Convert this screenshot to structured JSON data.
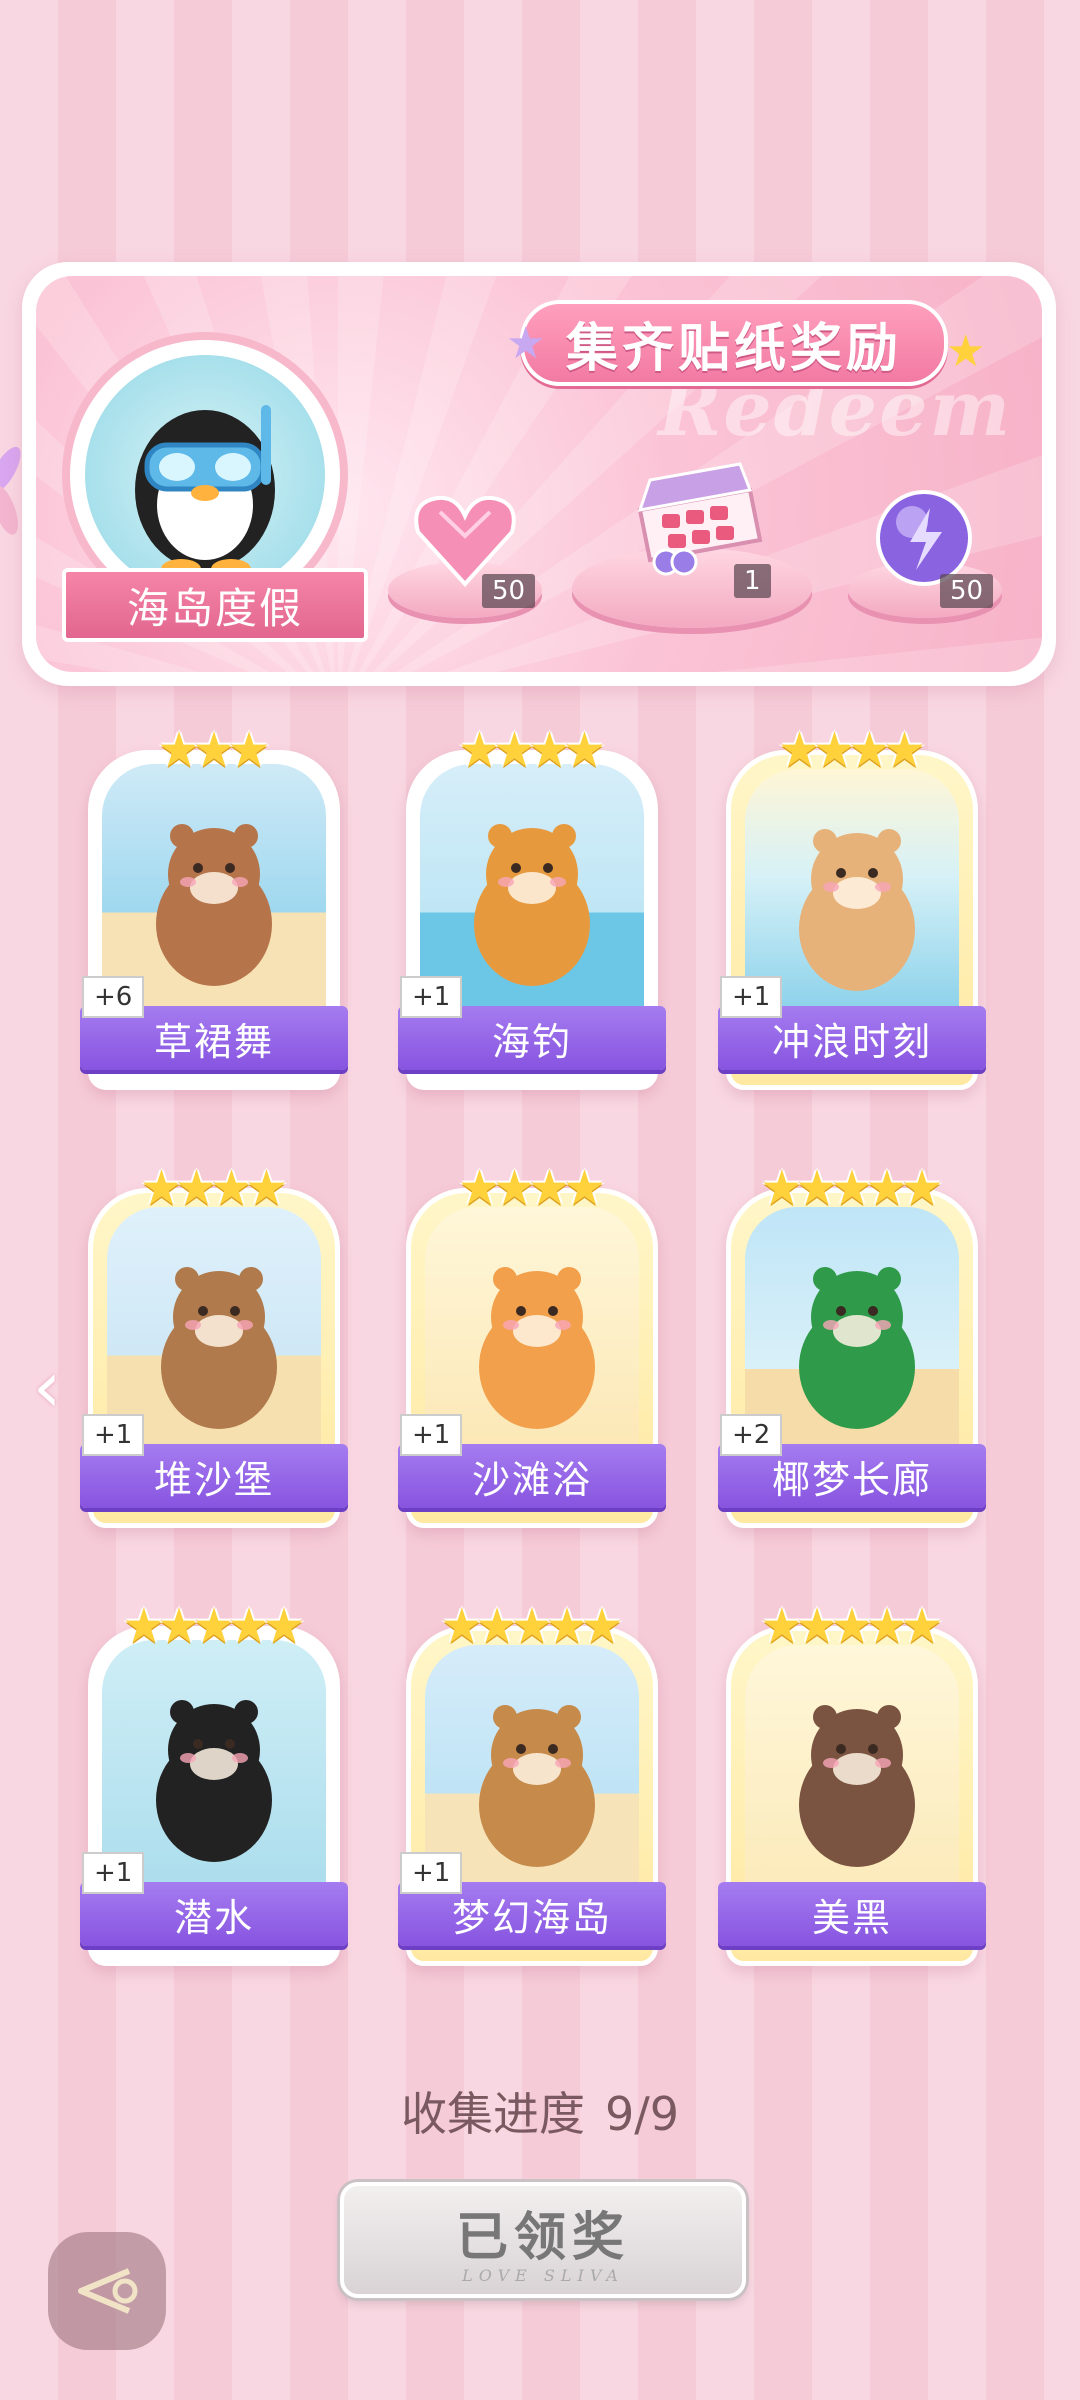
{
  "header": {
    "title": "集齐贴纸奖励",
    "bg_word": "Redeem",
    "set_name": "海岛度假",
    "rewards": [
      {
        "name": "heart-gem-icon",
        "count": "50"
      },
      {
        "name": "gift-box-icon",
        "count": "1"
      },
      {
        "name": "energy-orb-icon",
        "count": "50"
      }
    ]
  },
  "cards": [
    {
      "name": "草裙舞",
      "count": "+6",
      "stars": 3
    },
    {
      "name": "海钓",
      "count": "+1",
      "stars": 4
    },
    {
      "name": "冲浪时刻",
      "count": "+1",
      "stars": 4
    },
    {
      "name": "堆沙堡",
      "count": "+1",
      "stars": 4
    },
    {
      "name": "沙滩浴",
      "count": "+1",
      "stars": 4
    },
    {
      "name": "椰梦长廊",
      "count": "+2",
      "stars": 5
    },
    {
      "name": "潜水",
      "count": "+1",
      "stars": 5
    },
    {
      "name": "梦幻海岛",
      "count": "+1",
      "stars": 5
    },
    {
      "name": "美黑",
      "count": "",
      "stars": 5
    }
  ],
  "progress": {
    "label": "收集进度",
    "value": "9/9"
  },
  "claim_button": {
    "label": "已领奖",
    "sub": "LOVE SLIVA"
  },
  "colors": {
    "ribbon": "#8f5ee6",
    "panel": "#f7b2c8",
    "star": "#ffd23c"
  }
}
